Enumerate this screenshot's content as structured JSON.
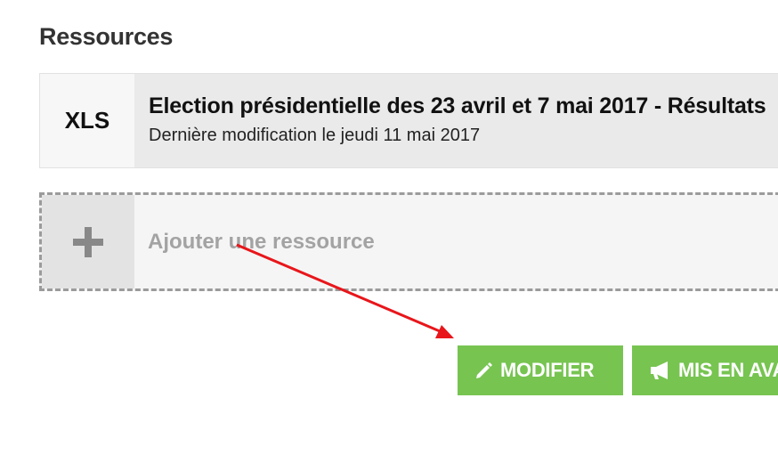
{
  "resources": {
    "heading": "Ressources",
    "items": [
      {
        "format": "XLS",
        "title": "Election présidentielle des 23 avril et 7 mai 2017 - Résultats",
        "meta": "Dernière modification le jeudi 11 mai 2017"
      }
    ],
    "add_label": "Ajouter une ressource"
  },
  "actions": {
    "edit_label": "MODIFIER",
    "promote_label": "MIS EN AVANT"
  },
  "colors": {
    "button_green": "#77c451",
    "annotation_arrow": "#e8161b"
  },
  "icons": {
    "add": "plus-icon",
    "edit": "pencil-icon",
    "promote": "megaphone-icon",
    "annotation": "red-arrow-annotation"
  }
}
